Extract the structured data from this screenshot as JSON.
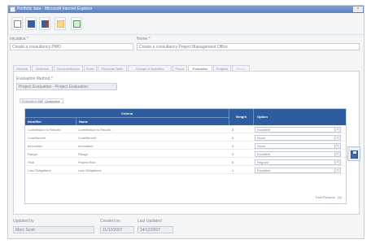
{
  "window": {
    "title": "Portfolio data - Microsoft Internet Explorer",
    "close_glyph": "×"
  },
  "toolbar": {
    "buttons": [
      "new-document-icon",
      "save-icon",
      "save-close-icon",
      "upload-icon",
      "check-icon"
    ],
    "colors": [
      "#7d8aa0",
      "#3b5f9c",
      "#c0392b",
      "#e8b84a",
      "#4aa04a"
    ]
  },
  "form": {
    "initiative_label": "Iniciativa",
    "initiative_value": "Create a consultancy PMO",
    "name_label": "Nome",
    "name_value": "Create a consultancy Project Management Office",
    "required_marker": "*"
  },
  "tabs": [
    {
      "label": "General",
      "active": false,
      "disabled": false
    },
    {
      "label": "Atributos",
      "active": false,
      "disabled": false
    },
    {
      "label": "Documentación",
      "active": false,
      "disabled": false
    },
    {
      "label": "Fluxo",
      "active": false,
      "disabled": false
    },
    {
      "label": "Financial Table",
      "active": false,
      "disabled": false
    },
    {
      "label": "Groups of Activities",
      "active": false,
      "disabled": false
    },
    {
      "label": "Focus",
      "active": false,
      "disabled": false
    },
    {
      "label": "Evaluation",
      "active": true,
      "disabled": false
    },
    {
      "label": "Projects",
      "active": false,
      "disabled": false
    },
    {
      "label": "Hidden",
      "active": false,
      "disabled": true
    }
  ],
  "evaluation": {
    "method_label": "Evaluation Method",
    "method_value": "Project Evaluation - Project Evaluation",
    "subtabs": [
      {
        "label": "Evaluation Matrix",
        "active": false
      },
      {
        "label": "Qualitative",
        "active": true
      }
    ]
  },
  "grid": {
    "criteria_header": "Criteria",
    "identifier_header": "Identifier",
    "name_header": "Name",
    "weight_header": "Weight",
    "option_header": "Option",
    "rows": [
      {
        "identifier": "Contribution to Results",
        "name": "Contribution to Results",
        "weight": "8",
        "option": "Excellent"
      },
      {
        "identifier": "Cost/Benefit",
        "name": "Cost/Benefit",
        "weight": "8",
        "option": "Good"
      },
      {
        "identifier": "Innovation",
        "name": "Innovation",
        "weight": "3",
        "option": "Good"
      },
      {
        "identifier": "Range",
        "name": "Range",
        "weight": "3",
        "option": "Excellent"
      },
      {
        "identifier": "Risk",
        "name": "Project Risk",
        "weight": "8",
        "option": "Regular"
      },
      {
        "identifier": "Law Obligations",
        "name": "Law Obligations",
        "weight": "4",
        "option": "Excellent"
      }
    ],
    "total_label": "Total Records : (6)",
    "dropdown_glyph": "▾"
  },
  "footer": {
    "updated_by_label": "Updated by",
    "updated_by_value": "Marc Scott",
    "created_on_label": "Created on",
    "created_on_value": "11/12/2007",
    "last_updated_label": "Last Updated",
    "last_updated_value": "14/12/2007"
  }
}
